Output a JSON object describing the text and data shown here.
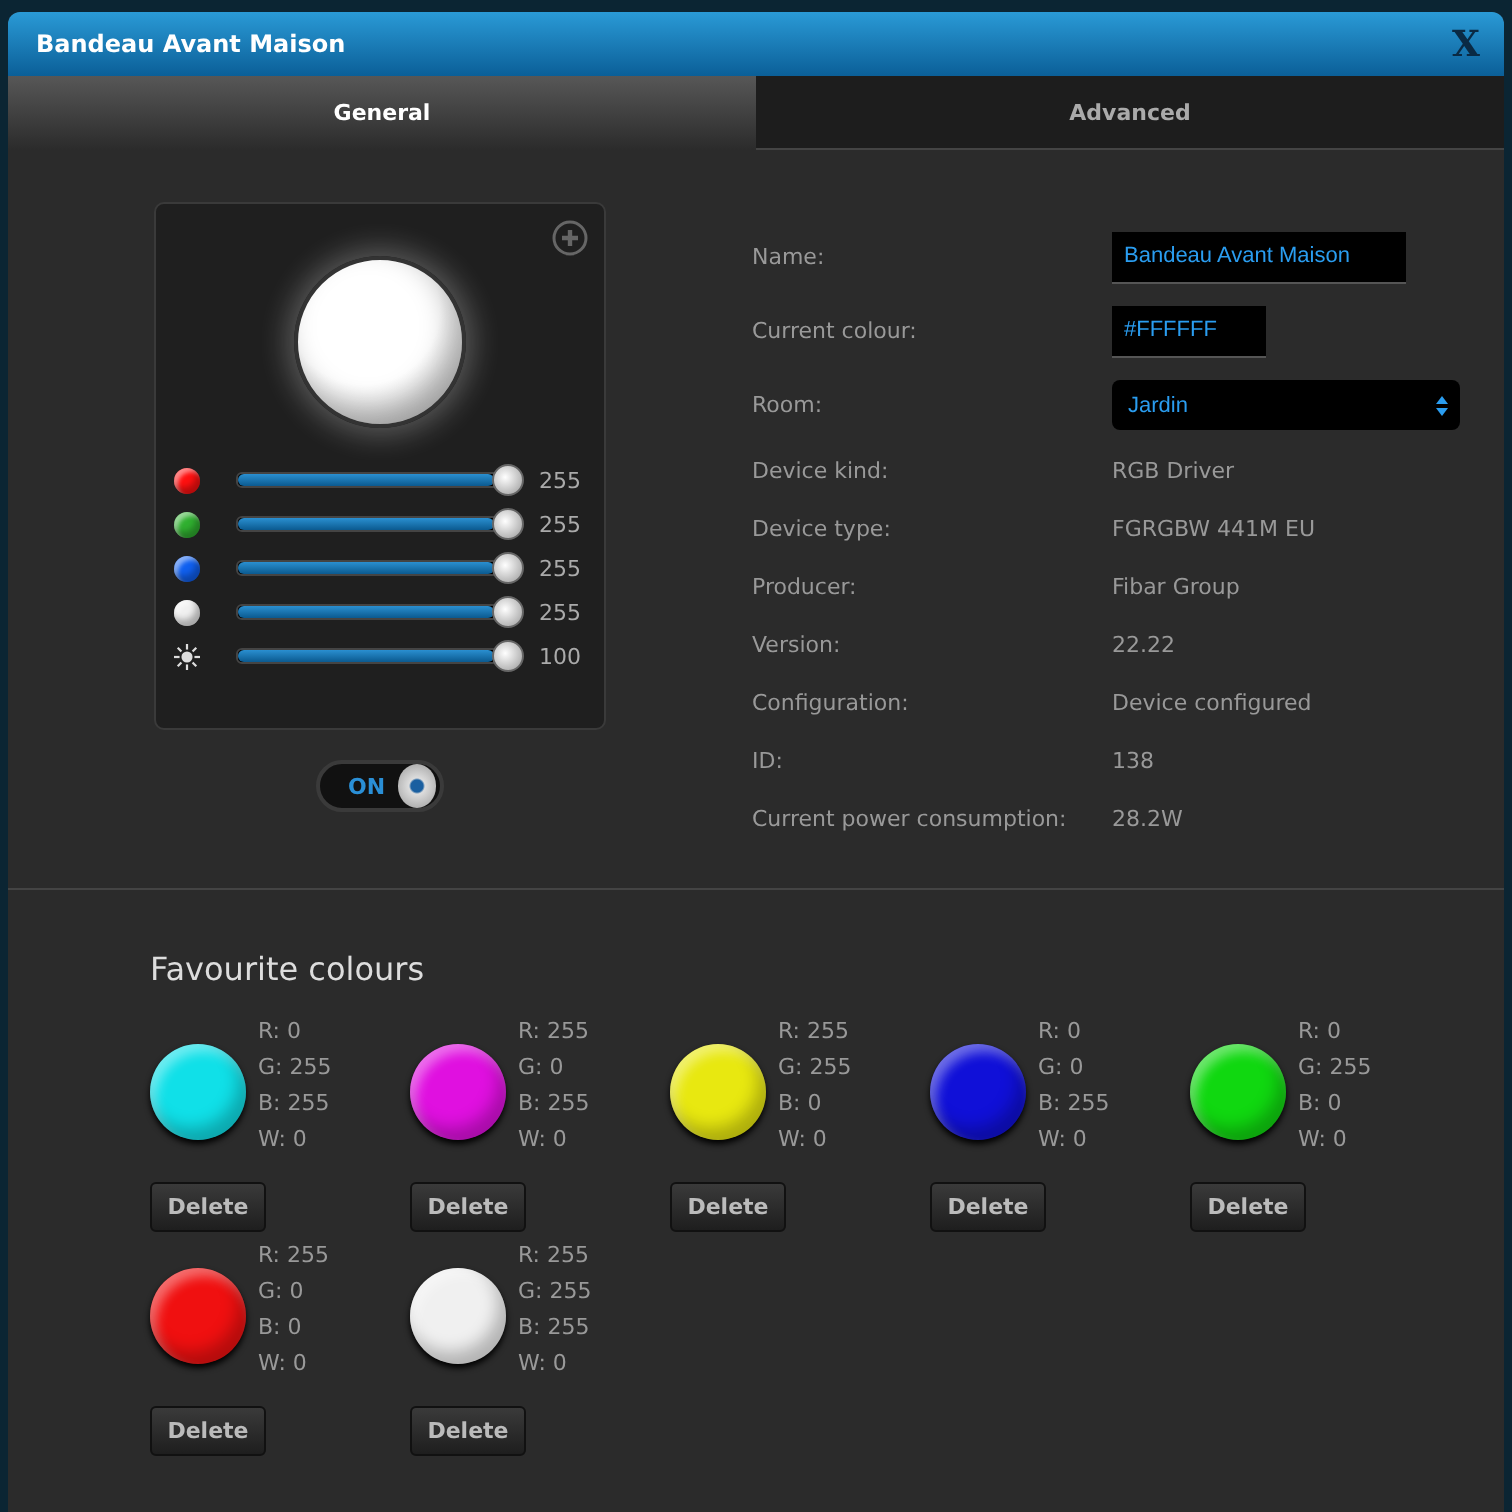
{
  "window": {
    "title": "Bandeau Avant Maison",
    "close": "X"
  },
  "tabs": [
    {
      "label": "General",
      "selected": true
    },
    {
      "label": "Advanced",
      "selected": false
    }
  ],
  "preview": {
    "color": "#ffffff"
  },
  "sliders": [
    {
      "kind": "dot",
      "color": "#ff1010",
      "level": 1,
      "reading": "255"
    },
    {
      "kind": "dot",
      "color": "#30b030",
      "level": 1,
      "reading": "255"
    },
    {
      "kind": "dot",
      "color": "#1060f0",
      "level": 1,
      "reading": "255"
    },
    {
      "kind": "dot",
      "color": "#f0f0f0",
      "level": 1,
      "reading": "255"
    },
    {
      "kind": "brightness",
      "level": 1,
      "reading": "100"
    }
  ],
  "toggle": {
    "label": "ON",
    "on": true
  },
  "info": [
    {
      "kind": "input",
      "label": "Name:",
      "value": "Bandeau Avant Maison"
    },
    {
      "kind": "input",
      "label": "Current colour:",
      "value": "#FFFFFF"
    },
    {
      "kind": "select",
      "label": "Room:",
      "value": "Jardin"
    },
    {
      "kind": "text",
      "label": "Device kind:",
      "value": "RGB Driver"
    },
    {
      "kind": "text",
      "label": "Device type:",
      "value": "FGRGBW 441M EU"
    },
    {
      "kind": "text",
      "label": "Producer:",
      "value": "Fibar Group"
    },
    {
      "kind": "text",
      "label": "Version:",
      "value": "22.22"
    },
    {
      "kind": "text",
      "label": "Configuration:",
      "value": "Device configured"
    },
    {
      "kind": "text",
      "label": "ID:",
      "value": "138"
    },
    {
      "kind": "text",
      "label": "Current power consumption:",
      "value": "28.2W"
    }
  ],
  "favourites": {
    "title": "Favourite colours",
    "items": [
      {
        "color": "#10e0e8",
        "values": [
          "R: 0",
          "G: 255",
          "B: 255",
          "W: 0"
        ],
        "button": "Delete"
      },
      {
        "color": "#e010e0",
        "values": [
          "R: 255",
          "G: 0",
          "B: 255",
          "W: 0"
        ],
        "button": "Delete"
      },
      {
        "color": "#e8e810",
        "values": [
          "R: 255",
          "G: 255",
          "B: 0",
          "W: 0"
        ],
        "button": "Delete"
      },
      {
        "color": "#1010d8",
        "values": [
          "R: 0",
          "G: 0",
          "B: 255",
          "W: 0"
        ],
        "button": "Delete"
      },
      {
        "color": "#10d810",
        "values": [
          "R: 0",
          "G: 255",
          "B: 0",
          "W: 0"
        ],
        "button": "Delete"
      },
      {
        "color": "#f01010",
        "values": [
          "R: 255",
          "G: 0",
          "B: 0",
          "W: 0"
        ],
        "button": "Delete"
      },
      {
        "color": "#f0f0f0",
        "values": [
          "R: 255",
          "G: 255",
          "B: 255",
          "W: 0"
        ],
        "button": "Delete"
      }
    ]
  }
}
